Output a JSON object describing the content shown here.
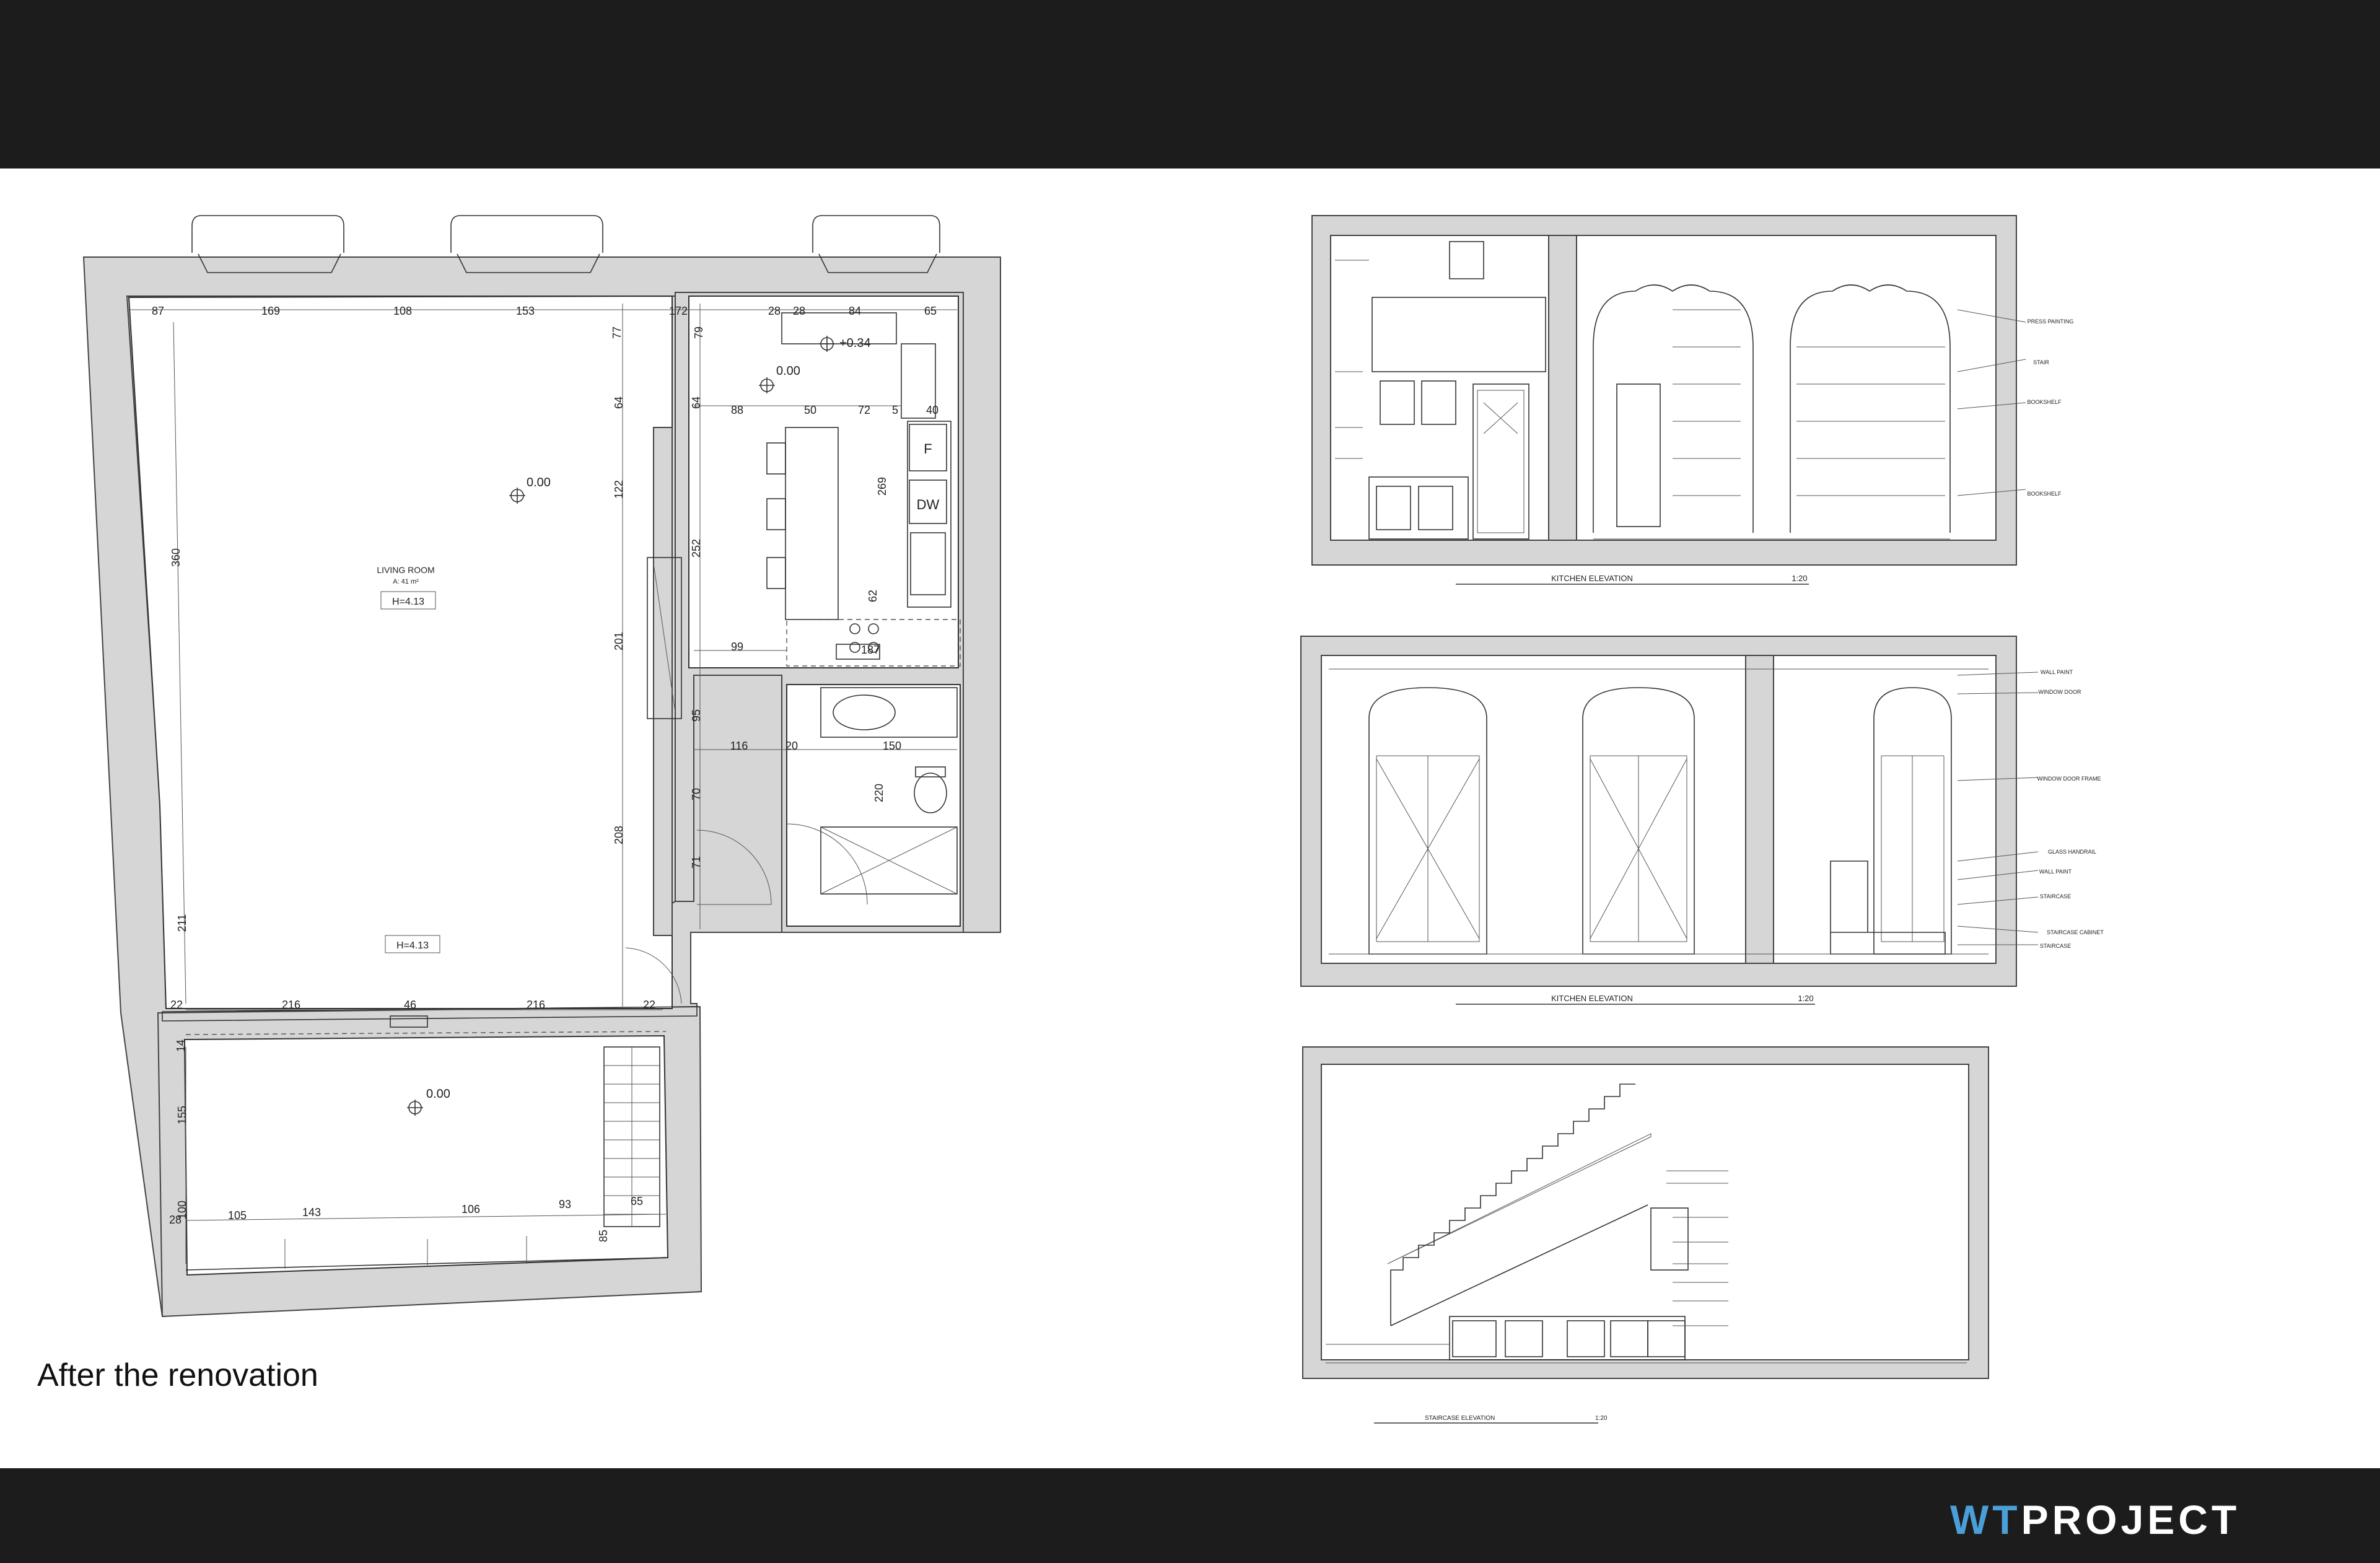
{
  "caption": "After the renovation",
  "logo": {
    "part1": "WT",
    "part2": "PROJECT"
  },
  "colors": {
    "band": "#1c1c1c",
    "logo_accent": "#4a9fd8",
    "wall_fill": "#d6d6d6"
  },
  "floor_plan": {
    "room_label": "LIVING ROOM",
    "room_area": "A: 41 m²",
    "height_label_1": "H=4.13",
    "height_label_2": "H=4.13",
    "level_living": "0.00",
    "level_kitchen": "0.00",
    "level_raised": "+0.34",
    "level_mezzanine": "0.00",
    "fridge_label": "F",
    "dishwasher_label": "DW",
    "top_dims": [
      "87",
      "169",
      "108",
      "153",
      "77",
      "172",
      "79",
      "28",
      "28",
      "84",
      "65"
    ],
    "kitchen_dims": [
      "88",
      "50",
      "72",
      "5",
      "40"
    ],
    "wall_dims": [
      "64",
      "64",
      "122",
      "252",
      "269",
      "62",
      "201",
      "95",
      "208",
      "70",
      "71",
      "211",
      "360",
      "99",
      "187",
      "116",
      "20",
      "150",
      "220"
    ],
    "bottom_dims": [
      "22",
      "216",
      "46",
      "216",
      "22"
    ],
    "mezz_dims": [
      "14",
      "155",
      "100",
      "28",
      "105",
      "143",
      "106",
      "93",
      "65",
      "85"
    ]
  },
  "elevations": [
    {
      "title": "KITCHEN ELEVATION",
      "scale": "1:20"
    },
    {
      "title": "KITCHEN ELEVATION",
      "scale": "1:20"
    },
    {
      "title": "STAIRCASE ELEVATION",
      "scale": "1:20"
    }
  ],
  "elevation_notes_1": [
    "PRESS PAINTING",
    "STAIR",
    "BOOKSHELF",
    "BOOKSHELF"
  ],
  "elevation_notes_2": [
    "WALL PAINT",
    "WINDOW DOOR",
    "WINDOW DOOR FRAME",
    "GLASS HANDRAIL",
    "WALL PAINT",
    "STAIRCASE",
    "STAIRCASE CABINET",
    "STAIRCASE"
  ]
}
